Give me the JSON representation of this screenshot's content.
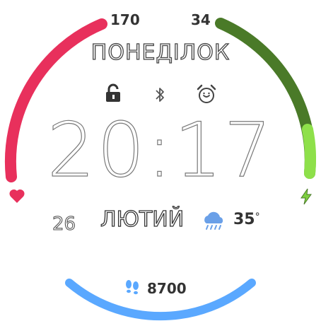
{
  "heart_rate": {
    "max_label": "170",
    "icon": "heart-icon",
    "color": "#e8305c",
    "level": 1.0
  },
  "battery": {
    "max_label": "34",
    "icon": "charging-bolt-icon",
    "color": "#4a7a28",
    "fill_color": "#8ee04a",
    "level": 0.34
  },
  "date": {
    "weekday": "ПОНЕДІЛОК",
    "day": "26",
    "month": "ЛЮТИЙ"
  },
  "status_icons": [
    "lock-open-icon",
    "bluetooth-icon",
    "alarm-clock-icon"
  ],
  "time": {
    "hours": "20",
    "separator": ":",
    "minutes": "17"
  },
  "weather": {
    "icon": "rain-cloud-icon",
    "temperature": "35",
    "unit_symbol": "°",
    "icon_color": "#6aa0e8"
  },
  "steps": {
    "value": "8700",
    "icon": "footsteps-icon",
    "color": "#5aa8ff"
  }
}
